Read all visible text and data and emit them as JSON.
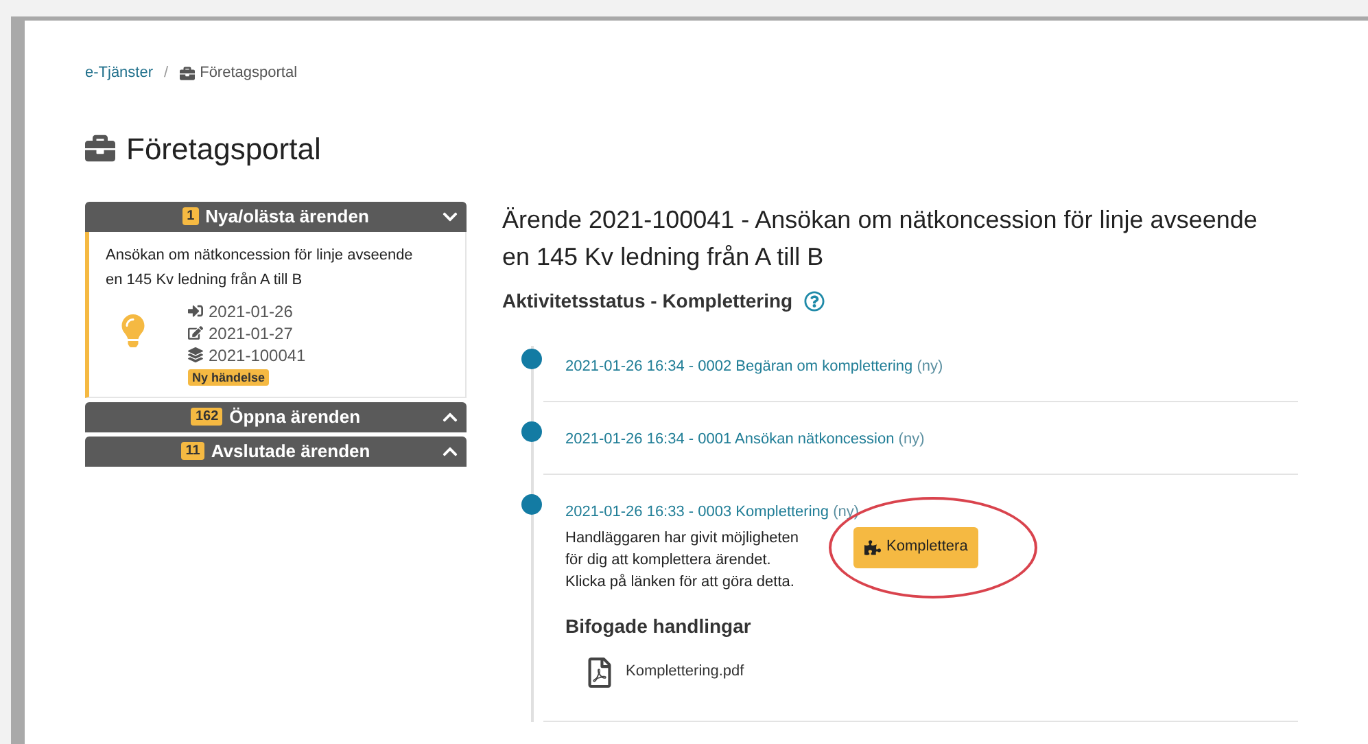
{
  "breadcrumb": [
    {
      "label": "e-Tjänster",
      "kind": "link"
    },
    {
      "label": "Företagsportal",
      "kind": "current"
    }
  ],
  "breadcrumb_separator": "/",
  "page_title": "Företagsportal",
  "panels": [
    {
      "count": "1",
      "title": "Nya/olästa ärenden",
      "expanded": true,
      "items": [
        {
          "title": "Ansökan om nätkoncession för linje avseende en 145 Kv ledning från A till B",
          "received": "2021-01-26",
          "edited": "2021-01-27",
          "case_number": "2021-100041",
          "badge": "Ny händelse"
        }
      ]
    },
    {
      "count": "162",
      "title": "Öppna ärenden",
      "expanded": false
    },
    {
      "count": "11",
      "title": "Avslutade ärenden",
      "expanded": false
    }
  ],
  "case": {
    "title": "Ärende 2021-100041 - Ansökan om nätkoncession för linje avseende en 145 Kv ledning från A till B",
    "status": "Aktivitetsstatus - Komplettering",
    "events": [
      {
        "link": "2021-01-26 16:34 - 0002 Begäran om komplettering",
        "tag": "(ny)"
      },
      {
        "link": "2021-01-26 16:34 - 0001 Ansökan nätkoncession",
        "tag": "(ny)"
      },
      {
        "link": "2021-01-26 16:33 - 0003 Komplettering",
        "tag": "(ny)",
        "description": [
          "Handläggaren har givit möjligheten",
          "för dig att komplettera ärendet.",
          "Klicka på länken för att göra detta."
        ],
        "button": "Komplettera",
        "highlighted": true,
        "attachments_title": "Bifogade handlingar",
        "attachments": [
          "Komplettering.pdf"
        ]
      }
    ]
  }
}
